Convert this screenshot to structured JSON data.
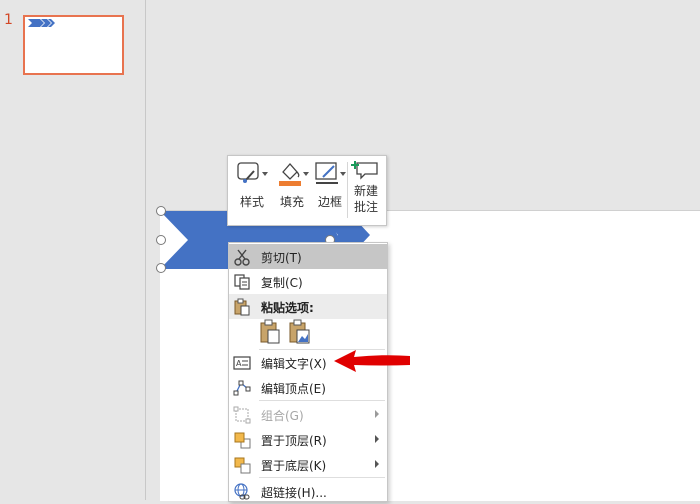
{
  "slide_pane": {
    "slide_number": "1"
  },
  "colors": {
    "shape_blue": "#4472c4",
    "thumb_border": "#e8734f",
    "arrow_red": "#e00000"
  },
  "mini_toolbar": {
    "style_label": "样式",
    "fill_label": "填充",
    "outline_label": "边框",
    "comment_label_line1": "新建",
    "comment_label_line2": "批注"
  },
  "context_menu": {
    "cut": "剪切(T)",
    "copy": "复制(C)",
    "paste_options": "粘贴选项:",
    "edit_text": "编辑文字(X)",
    "edit_points": "编辑顶点(E)",
    "group": "组合(G)",
    "bring_to_front": "置于顶层(R)",
    "send_to_back": "置于底层(K)",
    "hyperlink": "超链接(H)..."
  }
}
